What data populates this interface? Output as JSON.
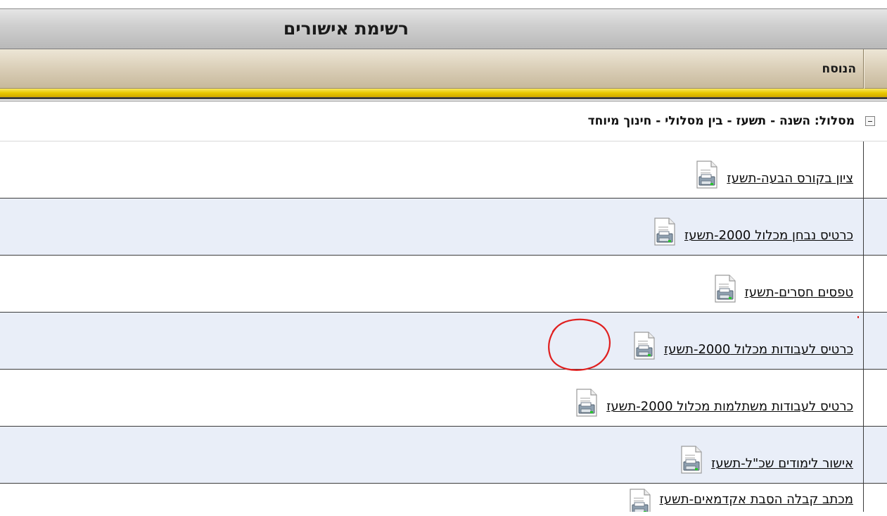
{
  "title_bar": {
    "title": "רשימת אישורים"
  },
  "column_header": {
    "label": "הנוסח"
  },
  "group": {
    "label": "מסלול: השנה - תשעז - בין מסלולי - חינוך מיוחד"
  },
  "rows": [
    {
      "label": "ציון בקורס הבעה-תשעז",
      "icon": "document-print-icon"
    },
    {
      "label": "כרטיס נבחן מכלול 2000-תשעז",
      "icon": "document-print-icon"
    },
    {
      "label": "טפסים חסרים-תשעז",
      "icon": "document-print-icon"
    },
    {
      "label": "כרטיס לעבודות מכלול 2000-תשעז",
      "icon": "document-print-icon"
    },
    {
      "label": "כרטיס לעבודות משתלמות מכלול 2000-תשעז",
      "icon": "document-print-icon"
    },
    {
      "label": "אישור לימודים שכ\"ל-תשעז",
      "icon": "document-print-icon"
    },
    {
      "label": "מכתב קבלה הסבת אקדמאים-תשעז",
      "icon": "document-print-icon"
    }
  ],
  "colors": {
    "alt_row": "#e9eef8",
    "gold_strip": "#e8c800",
    "annotation": "#e02020"
  }
}
